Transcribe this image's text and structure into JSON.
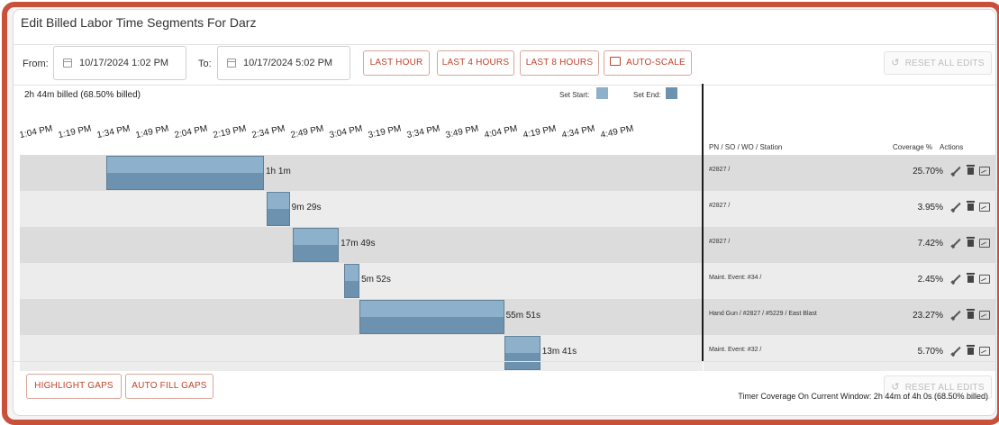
{
  "window": {
    "title": "Edit Billed Labor Time Segments For Darz"
  },
  "filters": {
    "from_label": "From:",
    "from_value": "10/17/2024 1:02 PM",
    "to_label": "To:",
    "to_value": "10/17/2024 5:02 PM",
    "last_hour": "LAST HOUR",
    "last_4_hours": "LAST 4 HOURS",
    "last_8_hours": "LAST 8 HOURS",
    "auto_scale": "AUTO-SCALE",
    "reset_all_edits": "RESET ALL EDITS"
  },
  "summary": {
    "billed": "2h 44m billed (68.50% billed)"
  },
  "legend": {
    "set_start": "Set Start:",
    "set_end": "Set End:",
    "start_color": "#8eb1cb",
    "end_color": "#6c92b0"
  },
  "timeline": {
    "ticks": [
      "1:04 PM",
      "1:19 PM",
      "1:34 PM",
      "1:49 PM",
      "2:04 PM",
      "2:19 PM",
      "2:34 PM",
      "2:49 PM",
      "3:04 PM",
      "3:19 PM",
      "3:34 PM",
      "3:49 PM",
      "4:04 PM",
      "4:19 PM",
      "4:34 PM",
      "4:49 PM"
    ],
    "segments": [
      {
        "duration": "1h 1m",
        "start": "1:33 PM",
        "end": "2:34 PM"
      },
      {
        "duration": "9m 29s",
        "start": "2:35 PM",
        "end": "2:44 PM"
      },
      {
        "duration": "17m 49s",
        "start": "2:45 PM",
        "end": "3:03 PM"
      },
      {
        "duration": "5m 52s",
        "start": "3:05 PM",
        "end": "3:11 PM"
      },
      {
        "duration": "55m 51s",
        "start": "3:11 PM",
        "end": "4:07 PM"
      },
      {
        "duration": "13m 41s",
        "start": "4:07 PM",
        "end": "4:21 PM"
      }
    ]
  },
  "table": {
    "headers": {
      "pn": "PN / SO / WO / Station",
      "coverage": "Coverage %",
      "actions": "Actions"
    },
    "rows": [
      {
        "pn": "#2827 /",
        "coverage": "25.70%"
      },
      {
        "pn": "#2827 /",
        "coverage": "3.95%"
      },
      {
        "pn": "#2827 /",
        "coverage": "7.42%"
      },
      {
        "pn": "Maint. Event: #34 /",
        "coverage": "2.45%"
      },
      {
        "pn": "Hand Gun / #2827 / #5229 / East Blast",
        "coverage": "23.27%"
      },
      {
        "pn": "Maint. Event: #32 /",
        "coverage": "5.70%"
      }
    ]
  },
  "footer": {
    "highlight_gaps": "HIGHLIGHT GAPS",
    "auto_fill_gaps": "AUTO FILL GAPS",
    "reset_all_edits": "RESET ALL EDITS",
    "coverage_text": "Timer Coverage On Current Window:  2h 44m of 4h 0s  (68.50% billed)"
  },
  "colors": {
    "accent": "#c0432c",
    "frame": "#c9503a",
    "divider": "#1b1b1b"
  }
}
